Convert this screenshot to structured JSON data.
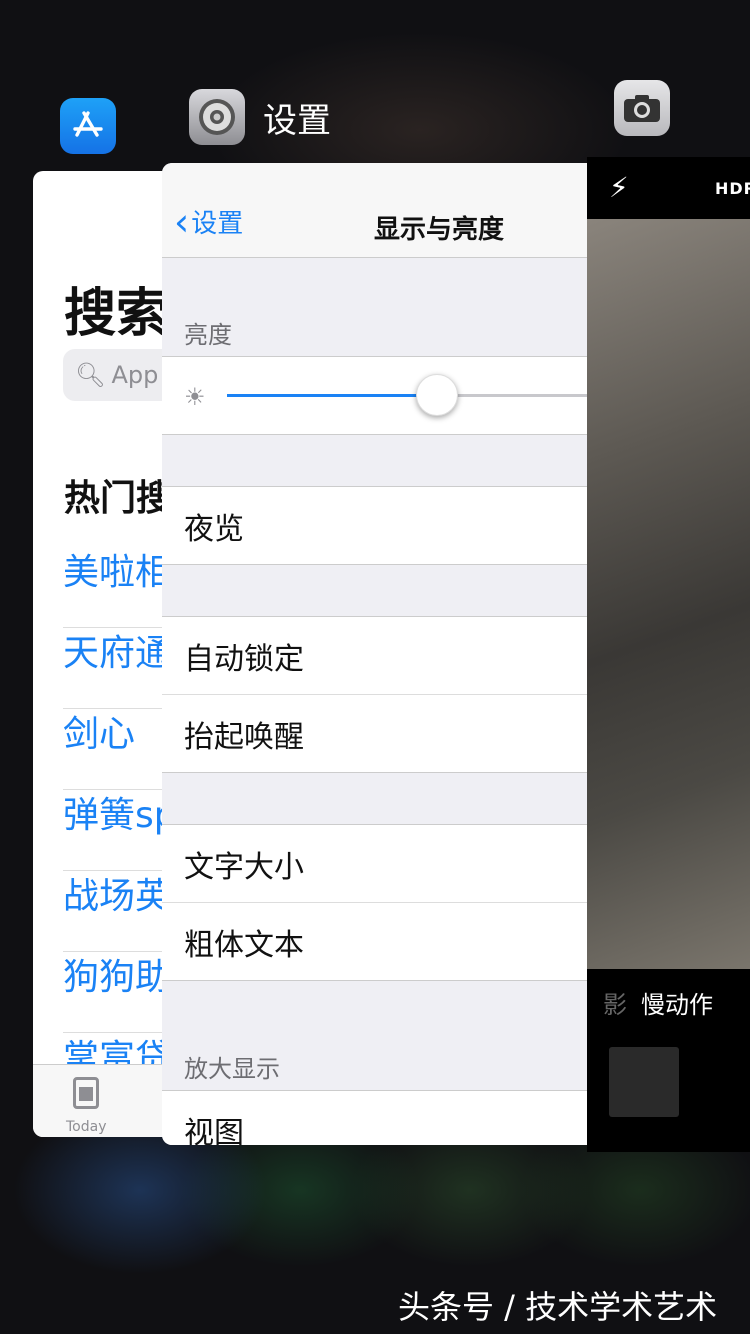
{
  "app_switcher": {
    "app_store": {
      "icon": "app-store-icon"
    },
    "settings": {
      "icon": "settings-gear-icon",
      "label": "设置"
    },
    "camera": {
      "icon": "camera-icon"
    }
  },
  "app_store_card": {
    "heading": "搜索",
    "search_placeholder": "App S",
    "hot_heading": "热门搜",
    "links": [
      "美啦相",
      "天府通",
      "剑心",
      "弹簧sp",
      "战场英",
      "狗狗助",
      "掌富贷"
    ],
    "tab_today": "Today"
  },
  "settings_card": {
    "back_label": "设置",
    "title": "显示与亮度",
    "brightness_header": "亮度",
    "brightness_value": 0.58,
    "night_shift": "夜览",
    "auto_lock": "自动锁定",
    "raise_to_wake": "抬起唤醒",
    "text_size": "文字大小",
    "bold_text": "粗体文本",
    "zoom_header": "放大显示",
    "view": "视图"
  },
  "camera_card": {
    "hdr": "HDR",
    "mode_prev": "影",
    "mode_current": "慢动作"
  },
  "watermark": "头条号 / 技术学术艺术",
  "colors": {
    "accent": "#1a82f5",
    "grouped_bg": "#efeff4"
  }
}
